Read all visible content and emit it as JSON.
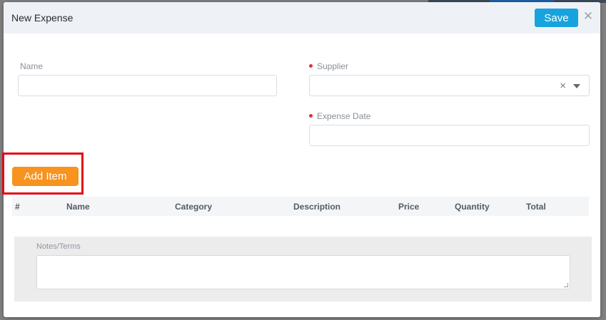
{
  "modal": {
    "title": "New Expense",
    "save_label": "Save",
    "close_icon": "close-icon"
  },
  "form": {
    "name": {
      "label": "Name",
      "value": ""
    },
    "supplier": {
      "label": "Supplier",
      "required": true,
      "value": "",
      "clear_glyph": "×"
    },
    "expense_date": {
      "label": "Expense Date",
      "required": true,
      "value": ""
    }
  },
  "items": {
    "add_item_label": "Add Item",
    "columns": [
      "#",
      "Name",
      "Category",
      "Description",
      "Price",
      "Quantity",
      "Total"
    ]
  },
  "notes": {
    "label": "Notes/Terms",
    "value": ""
  },
  "colors": {
    "save_button": "#17a4de",
    "add_item_button": "#f7931e",
    "required_marker": "#e0303a",
    "highlight_box": "#e30613",
    "header_bg": "#eef2f7"
  }
}
